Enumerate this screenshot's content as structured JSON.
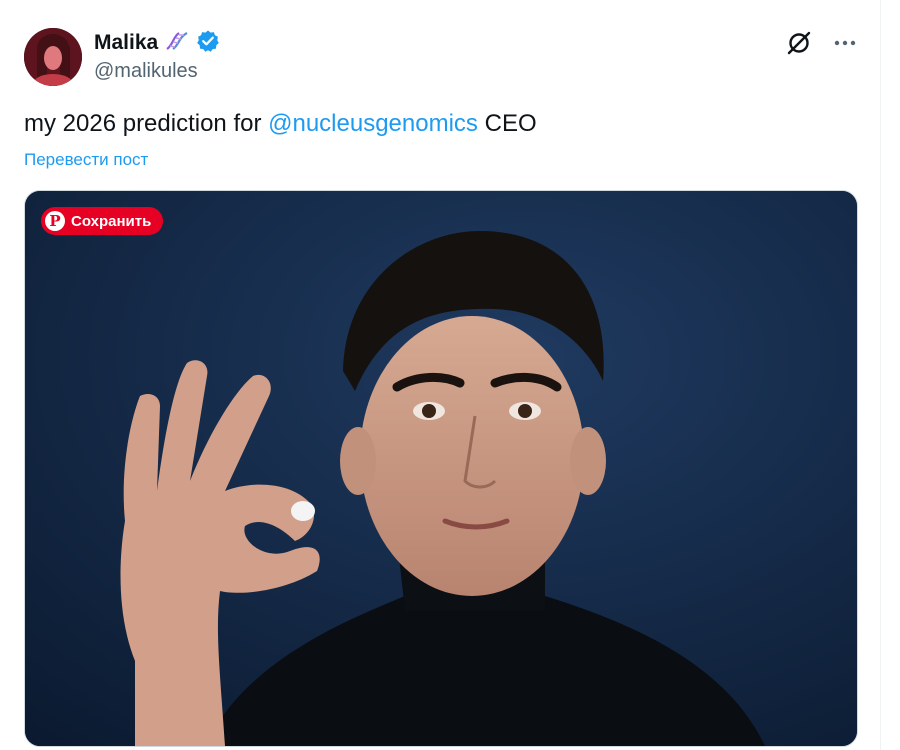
{
  "author": {
    "display_name": "Malika",
    "handle": "@malikules",
    "badge_emoji": "dna-emoji",
    "verified_icon": "verified-badge-icon",
    "verified_color": "#1d9bf0"
  },
  "tweet": {
    "text_before": "my 2026 prediction for ",
    "mention": "@nucleusgenomics",
    "text_after": " CEO",
    "translate_label": "Перевести пост"
  },
  "toolbar": {
    "grok_icon": "grok-icon",
    "more_icon": "more-dots-icon"
  },
  "media": {
    "pinterest_save_label": "Сохранить",
    "pinterest_color": "#e60023",
    "image_description_icon": "photo-man-holding-pill"
  },
  "colors": {
    "link": "#1d9bf0",
    "secondary_text": "#536471",
    "primary_text": "#0f1419"
  }
}
